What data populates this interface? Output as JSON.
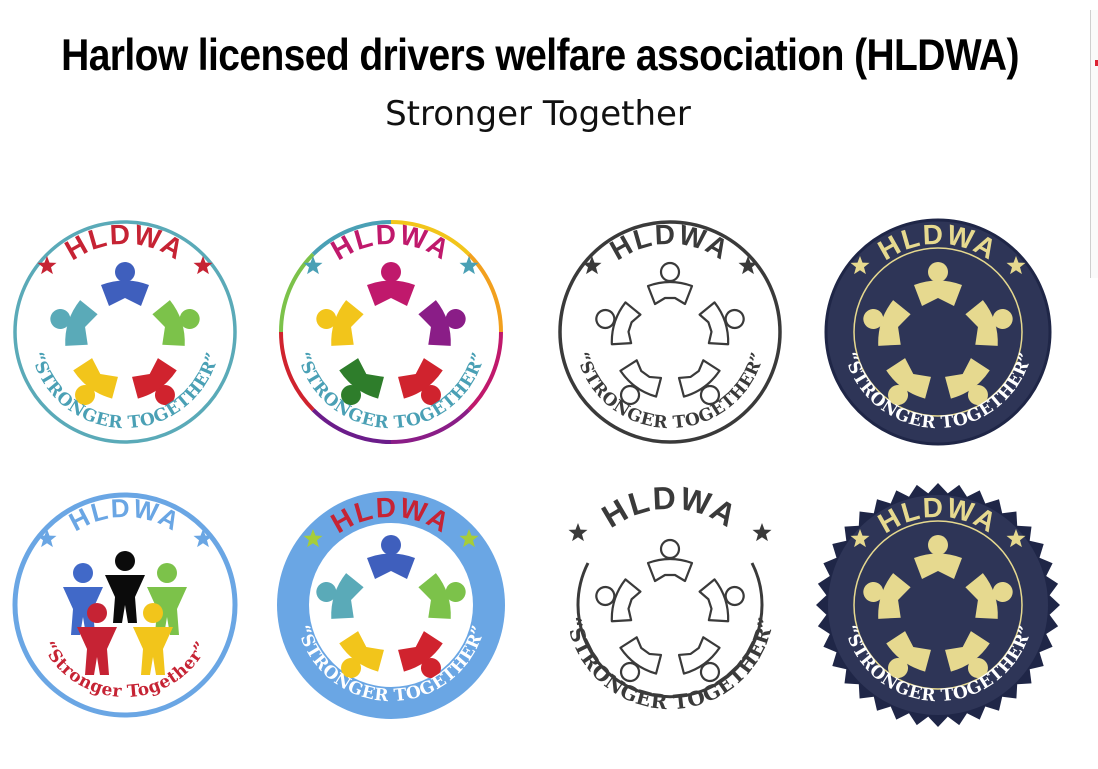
{
  "header": {
    "title": "Harlow licensed drivers welfare association (HLDWA)",
    "tagline": "Stronger Together"
  },
  "logos": [
    {
      "acronym": "HLDWA",
      "slogan": "“STRONGER TOGETHER”",
      "style": "multicolor-figures-teal-ring",
      "colors": {
        "ring": "#5aaab8",
        "acronym": "#c62334",
        "star": "#c62334",
        "slogan": "#4aa0b5",
        "figures": [
          "#3f5fbd",
          "#7cc24a",
          "#d0232e",
          "#f2c51b",
          "#5aaab8",
          "#a6cd3a"
        ]
      }
    },
    {
      "acronym": "HLDWA",
      "slogan": "“STRONGER TOGETHER”",
      "style": "rainbow-ring-bold-figures",
      "colors": {
        "ring": [
          "#f2c51b",
          "#f2a01e",
          "#c0196c",
          "#8a1d87",
          "#6b1c8a",
          "#d0232e",
          "#7cc24a",
          "#4aa0b5"
        ],
        "acronym": "#c0196c",
        "star": "#4aa0b5",
        "slogan": "#4aa0b5",
        "figures": [
          "#c0196c",
          "#8a1d87",
          "#d0232e",
          "#2e7d2b",
          "#f2c51b"
        ]
      }
    },
    {
      "acronym": "HLDWA",
      "slogan": "“STRONGER TOGETHER”",
      "style": "outline-dark",
      "colors": {
        "ring": "#3a3a3a",
        "acronym": "#3a3a3a",
        "star": "#3a3a3a",
        "slogan": "#3a3a3a",
        "figures": [
          "#3a3a3a"
        ]
      }
    },
    {
      "acronym": "HLDWA",
      "slogan": "“STRONGER TOGETHER”",
      "style": "navy-gold-badge",
      "colors": {
        "fill": "#2e3557",
        "ring": "#e6d98f",
        "acronym": "#e6d98f",
        "star": "#e6d98f",
        "slogan": "#ffffff",
        "figures": [
          "#e6d98f"
        ]
      }
    },
    {
      "acronym": "HLDWA",
      "slogan": "“Stronger Together”",
      "style": "light-blue-ring-standing-people",
      "colors": {
        "ring": "#6aa6e4",
        "acronym": "#6aa6e4",
        "star": "#6aa6e4",
        "slogan": "#c62334",
        "figures": [
          "#4169c8",
          "#0b0b0b",
          "#7cc24a",
          "#c62334",
          "#f2c51b"
        ]
      }
    },
    {
      "acronym": "HLDWA",
      "slogan": "“STRONGER TOGETHER”",
      "style": "blue-band-multicolor-figures",
      "colors": {
        "ring": "#6aa6e4",
        "acronym": "#c62334",
        "star": "#a6cd3a",
        "slogan": "#ffffff",
        "figures": [
          "#3f5fbd",
          "#7cc24a",
          "#d0232e",
          "#f2c51b",
          "#5aaab8",
          "#a6cd3a"
        ]
      }
    },
    {
      "acronym": "HLDWA",
      "slogan": "“STRONGER TOGETHER”",
      "style": "outline-open-arc",
      "colors": {
        "ring": "#3a3a3a",
        "acronym": "#3a3a3a",
        "star": "#3a3a3a",
        "slogan": "#3a3a3a",
        "figures": [
          "#3a3a3a"
        ]
      }
    },
    {
      "acronym": "HLDWA",
      "slogan": "“STRONGER TOGETHER”",
      "style": "navy-gold-seal",
      "colors": {
        "fill": "#2e3557",
        "ring": "#e6d98f",
        "acronym": "#e6d98f",
        "star": "#e6d98f",
        "slogan": "#ffffff",
        "figures": [
          "#e6d98f"
        ]
      }
    }
  ]
}
